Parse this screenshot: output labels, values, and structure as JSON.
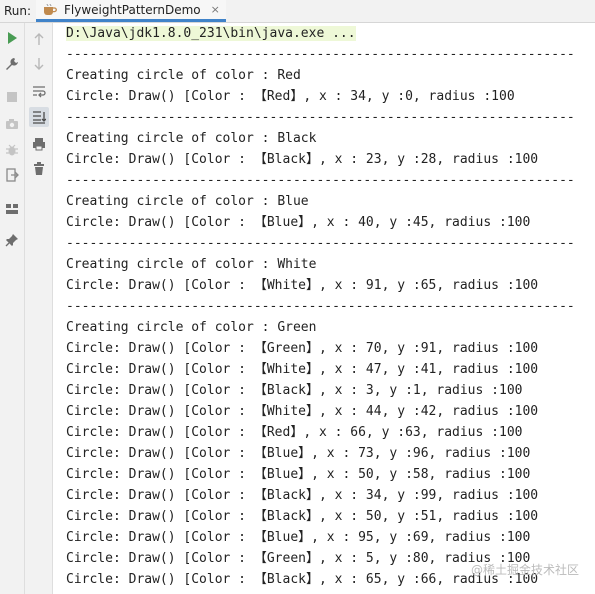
{
  "run_label": "Run:",
  "tab": {
    "title": "FlyweightPatternDemo",
    "close": "×"
  },
  "toolbar": {
    "left": [
      "run-icon",
      "wrench-icon",
      "stop-icon",
      "camera-icon",
      "bug-settings-icon",
      "exit-icon",
      "layout-icon",
      "pin-icon"
    ],
    "mid": [
      "arrow-up-icon",
      "arrow-down-icon",
      "soft-wrap-icon",
      "scroll-to-end-icon",
      "print-icon",
      "trash-icon"
    ]
  },
  "console": {
    "lines": [
      "D:\\Java\\jdk1.8.0_231\\bin\\java.exe ...",
      "-----------------------------------------------------------------",
      "Creating circle of color : Red",
      "Circle: Draw() [Color : 【Red】, x : 34, y :0, radius :100",
      "-----------------------------------------------------------------",
      "Creating circle of color : Black",
      "Circle: Draw() [Color : 【Black】, x : 23, y :28, radius :100",
      "-----------------------------------------------------------------",
      "Creating circle of color : Blue",
      "Circle: Draw() [Color : 【Blue】, x : 40, y :45, radius :100",
      "-----------------------------------------------------------------",
      "Creating circle of color : White",
      "Circle: Draw() [Color : 【White】, x : 91, y :65, radius :100",
      "-----------------------------------------------------------------",
      "Creating circle of color : Green",
      "Circle: Draw() [Color : 【Green】, x : 70, y :91, radius :100",
      "Circle: Draw() [Color : 【White】, x : 47, y :41, radius :100",
      "Circle: Draw() [Color : 【Black】, x : 3, y :1, radius :100",
      "Circle: Draw() [Color : 【White】, x : 44, y :42, radius :100",
      "Circle: Draw() [Color : 【Red】, x : 66, y :63, radius :100",
      "Circle: Draw() [Color : 【Blue】, x : 73, y :96, radius :100",
      "Circle: Draw() [Color : 【Blue】, x : 50, y :58, radius :100",
      "Circle: Draw() [Color : 【Black】, x : 34, y :99, radius :100",
      "Circle: Draw() [Color : 【Black】, x : 50, y :51, radius :100",
      "Circle: Draw() [Color : 【Blue】, x : 95, y :69, radius :100",
      "Circle: Draw() [Color : 【Green】, x : 5, y :80, radius :100",
      "Circle: Draw() [Color : 【Black】, x : 65, y :66, radius :100"
    ]
  },
  "watermark": "@稀土掘金技术社区",
  "colors": {
    "run_green": "#499c54",
    "tab_underline": "#4083c9",
    "command_bg": "#eef8d7"
  }
}
